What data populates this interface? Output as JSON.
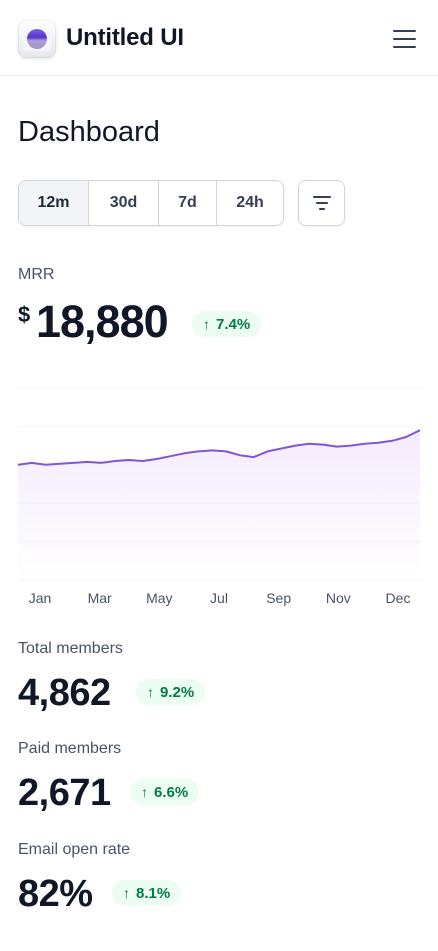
{
  "header": {
    "brand": "Untitled UI"
  },
  "page": {
    "title": "Dashboard"
  },
  "filters": {
    "ranges": [
      "12m",
      "30d",
      "7d",
      "24h"
    ],
    "selected": "12m"
  },
  "mrr": {
    "label": "MRR",
    "currency": "$",
    "value": "18,880",
    "change": "7.4%",
    "trend": "up"
  },
  "chart_data": {
    "type": "area",
    "title": "",
    "xlabel": "",
    "ylabel": "",
    "x_tick_labels": [
      "Jan",
      "Mar",
      "May",
      "Jul",
      "Sep",
      "Nov",
      "Dec"
    ],
    "grid": true,
    "ylim": [
      0,
      100
    ],
    "series": [
      {
        "values": [
          60,
          61,
          60,
          60.5,
          61,
          61.5,
          61,
          62,
          62.5,
          62,
          63,
          64.5,
          66,
          67,
          67.5,
          67,
          65,
          64,
          67,
          68.5,
          70,
          71,
          70.5,
          69.5,
          70,
          71,
          71.5,
          72.5,
          74.5,
          78
        ]
      }
    ],
    "colors": {
      "line": "#7f56d9",
      "fill_top": "#f4ebff",
      "grid": "#f2f4f7"
    }
  },
  "stats": [
    {
      "label": "Total members",
      "value": "4,862",
      "change": "9.2%",
      "trend": "up"
    },
    {
      "label": "Paid members",
      "value": "2,671",
      "change": "6.6%",
      "trend": "up"
    },
    {
      "label": "Email open rate",
      "value": "82%",
      "change": "8.1%",
      "trend": "up"
    }
  ],
  "icons": {
    "logo": "logo-orb-icon",
    "menu": "hamburger-menu-icon",
    "filter": "filter-lines-icon",
    "trend": "arrow-up-icon"
  },
  "colors": {
    "accent": "#7f56d9",
    "success_text": "#027a48",
    "success_bg": "#ecfdf3",
    "text_primary": "#101828",
    "text_secondary": "#475467",
    "border": "#d0d5dd"
  }
}
